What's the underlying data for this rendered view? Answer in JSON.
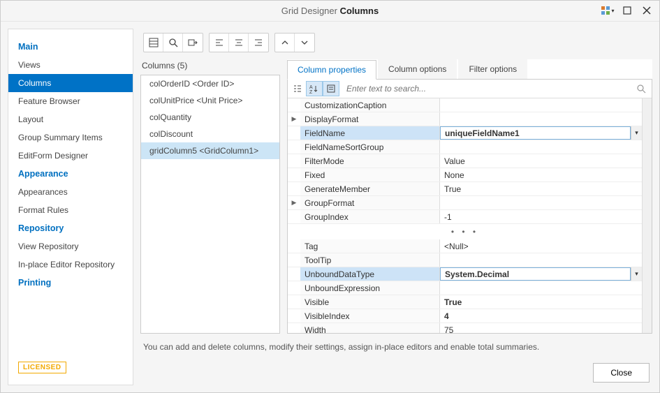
{
  "title": {
    "prefix": "Grid Designer",
    "main": "Columns"
  },
  "sidebar": {
    "sections": [
      {
        "title": "Main",
        "items": [
          "Views",
          "Columns",
          "Feature Browser",
          "Layout",
          "Group Summary Items",
          "EditForm Designer"
        ],
        "activeIndex": 1
      },
      {
        "title": "Appearance",
        "items": [
          "Appearances",
          "Format Rules"
        ]
      },
      {
        "title": "Repository",
        "items": [
          "View Repository",
          "In-place Editor Repository"
        ]
      },
      {
        "title": "Printing",
        "items": []
      }
    ],
    "licensed": "LICENSED"
  },
  "columns": {
    "header": "Columns (5)",
    "items": [
      "colOrderID <Order ID>",
      "colUnitPrice <Unit Price>",
      "colQuantity",
      "colDiscount",
      "gridColumn5 <GridColumn1>"
    ],
    "selectedIndex": 4
  },
  "tabs": [
    "Column properties",
    "Column options",
    "Filter options"
  ],
  "activeTab": 0,
  "search": {
    "placeholder": "Enter text to search..."
  },
  "props": {
    "rowsTop": [
      {
        "name": "CustomizationCaption",
        "value": ""
      },
      {
        "name": "DisplayFormat",
        "value": "",
        "expandable": true
      },
      {
        "name": "FieldName",
        "value": "uniqueFieldName1",
        "bold": true,
        "selected": true,
        "dropdown": true
      },
      {
        "name": "FieldNameSortGroup",
        "value": ""
      },
      {
        "name": "FilterMode",
        "value": "Value"
      },
      {
        "name": "Fixed",
        "value": "None"
      },
      {
        "name": "GenerateMember",
        "value": "True"
      },
      {
        "name": "GroupFormat",
        "value": "",
        "expandable": true
      },
      {
        "name": "GroupIndex",
        "value": "-1"
      }
    ],
    "rowsBottom": [
      {
        "name": "Tag",
        "value": "<Null>"
      },
      {
        "name": "ToolTip",
        "value": ""
      },
      {
        "name": "UnboundDataType",
        "value": "System.Decimal",
        "bold": true,
        "selected": true,
        "dropdown": true
      },
      {
        "name": "UnboundExpression",
        "value": ""
      },
      {
        "name": "Visible",
        "value": "True",
        "bold": true
      },
      {
        "name": "VisibleIndex",
        "value": "4",
        "bold": true
      },
      {
        "name": "Width",
        "value": "75"
      }
    ]
  },
  "hint": "You can add and delete columns, modify their settings, assign in-place editors and enable total summaries.",
  "closeLabel": "Close"
}
